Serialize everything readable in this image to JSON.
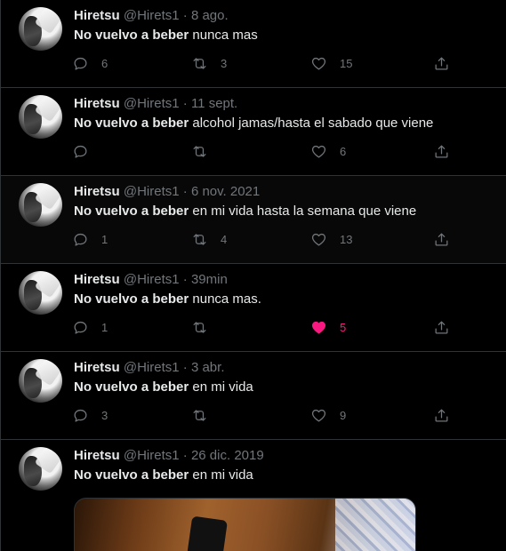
{
  "colors": {
    "background": "#000000",
    "text": "#e7e9ea",
    "muted": "#71767b",
    "like_active": "#f91880",
    "border": "#2f3336"
  },
  "icons": {
    "reply": "reply-icon",
    "retweet": "retweet-icon",
    "like": "heart-icon",
    "share": "share-icon"
  },
  "tweets": [
    {
      "name": "Hiretsu",
      "handle": "@Hirets1",
      "sep": "·",
      "time": "8 ago.",
      "bold": "No vuelvo a beber",
      "rest": " nunca mas",
      "replies": "6",
      "retweets": "3",
      "likes": "15",
      "liked": false
    },
    {
      "name": "Hiretsu",
      "handle": "@Hirets1",
      "sep": "·",
      "time": "11 sept.",
      "bold": "No vuelvo a beber",
      "rest": " alcohol jamas/hasta el sabado que viene",
      "replies": "",
      "retweets": "",
      "likes": "6",
      "liked": false
    },
    {
      "name": "Hiretsu",
      "handle": "@Hirets1",
      "sep": "·",
      "time": "6 nov. 2021",
      "bold": "No vuelvo a beber",
      "rest": " en mi vida hasta la semana que viene",
      "replies": "1",
      "retweets": "4",
      "likes": "13",
      "liked": false
    },
    {
      "name": "Hiretsu",
      "handle": "@Hirets1",
      "sep": "·",
      "time": "39min",
      "bold": "No vuelvo a beber",
      "rest": " nunca mas.",
      "replies": "1",
      "retweets": "",
      "likes": "5",
      "liked": true
    },
    {
      "name": "Hiretsu",
      "handle": "@Hirets1",
      "sep": "·",
      "time": "3 abr.",
      "bold": "No vuelvo a beber",
      "rest": " en mi vida",
      "replies": "3",
      "retweets": "",
      "likes": "9",
      "liked": false
    },
    {
      "name": "Hiretsu",
      "handle": "@Hirets1",
      "sep": "·",
      "time": "26 dic. 2019",
      "bold": "No vuelvo a beber",
      "rest": " en mi vida",
      "has_media": true
    }
  ]
}
